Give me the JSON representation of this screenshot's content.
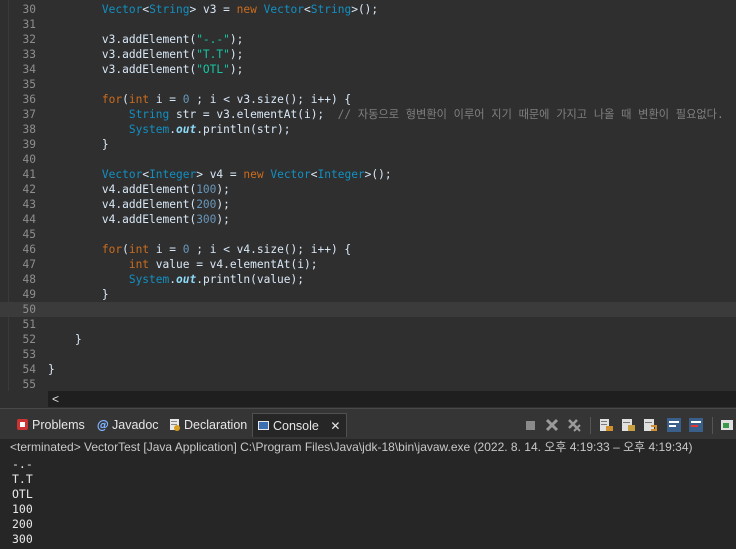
{
  "editor": {
    "lines": [
      {
        "num": "30",
        "tokens": [
          [
            "pl",
            "        "
          ],
          [
            "ty",
            "Vector"
          ],
          [
            "pl",
            "<"
          ],
          [
            "ty",
            "String"
          ],
          [
            "pl",
            "> v3 = "
          ],
          [
            "kw",
            "new"
          ],
          [
            "pl",
            " "
          ],
          [
            "ty",
            "Vector"
          ],
          [
            "pl",
            "<"
          ],
          [
            "ty",
            "String"
          ],
          [
            "pl",
            ">();"
          ]
        ]
      },
      {
        "num": "31",
        "tokens": []
      },
      {
        "num": "32",
        "tokens": [
          [
            "pl",
            "        v3.addElement("
          ],
          [
            "st",
            "\"-.-\""
          ],
          [
            "pl",
            ");"
          ]
        ]
      },
      {
        "num": "33",
        "tokens": [
          [
            "pl",
            "        v3.addElement("
          ],
          [
            "st",
            "\"T.T\""
          ],
          [
            "pl",
            ");"
          ]
        ]
      },
      {
        "num": "34",
        "tokens": [
          [
            "pl",
            "        v3.addElement("
          ],
          [
            "st",
            "\"OTL\""
          ],
          [
            "pl",
            ");"
          ]
        ]
      },
      {
        "num": "35",
        "tokens": []
      },
      {
        "num": "36",
        "tokens": [
          [
            "pl",
            "        "
          ],
          [
            "kw",
            "for"
          ],
          [
            "pl",
            "("
          ],
          [
            "kw",
            "int"
          ],
          [
            "pl",
            " i = "
          ],
          [
            "nm",
            "0"
          ],
          [
            "pl",
            " ; i < v3.size(); i++) {"
          ]
        ]
      },
      {
        "num": "37",
        "tokens": [
          [
            "pl",
            "            "
          ],
          [
            "ty",
            "String"
          ],
          [
            "pl",
            " str = v3.elementAt(i);  "
          ],
          [
            "cm",
            "// 자동으로 형변환이 이루어 지기 때문에 가지고 나올 때 변환이 필요없다."
          ]
        ]
      },
      {
        "num": "38",
        "tokens": [
          [
            "pl",
            "            "
          ],
          [
            "bi",
            "System"
          ],
          [
            "pl",
            "."
          ],
          [
            "fi",
            "out"
          ],
          [
            "pl",
            ".println(str);"
          ]
        ]
      },
      {
        "num": "39",
        "tokens": [
          [
            "pl",
            "        }"
          ]
        ]
      },
      {
        "num": "40",
        "tokens": []
      },
      {
        "num": "41",
        "tokens": [
          [
            "pl",
            "        "
          ],
          [
            "ty",
            "Vector"
          ],
          [
            "pl",
            "<"
          ],
          [
            "ty",
            "Integer"
          ],
          [
            "pl",
            "> v4 = "
          ],
          [
            "kw",
            "new"
          ],
          [
            "pl",
            " "
          ],
          [
            "ty",
            "Vector"
          ],
          [
            "pl",
            "<"
          ],
          [
            "ty",
            "Integer"
          ],
          [
            "pl",
            ">();"
          ]
        ]
      },
      {
        "num": "42",
        "tokens": [
          [
            "pl",
            "        v4.addElement("
          ],
          [
            "nm",
            "100"
          ],
          [
            "pl",
            ");"
          ]
        ]
      },
      {
        "num": "43",
        "tokens": [
          [
            "pl",
            "        v4.addElement("
          ],
          [
            "nm",
            "200"
          ],
          [
            "pl",
            ");"
          ]
        ]
      },
      {
        "num": "44",
        "tokens": [
          [
            "pl",
            "        v4.addElement("
          ],
          [
            "nm",
            "300"
          ],
          [
            "pl",
            ");"
          ]
        ]
      },
      {
        "num": "45",
        "tokens": []
      },
      {
        "num": "46",
        "tokens": [
          [
            "pl",
            "        "
          ],
          [
            "kw",
            "for"
          ],
          [
            "pl",
            "("
          ],
          [
            "kw",
            "int"
          ],
          [
            "pl",
            " i = "
          ],
          [
            "nm",
            "0"
          ],
          [
            "pl",
            " ; i < v4.size(); i++) {"
          ]
        ]
      },
      {
        "num": "47",
        "tokens": [
          [
            "pl",
            "            "
          ],
          [
            "kw",
            "int"
          ],
          [
            "pl",
            " value = v4.elementAt(i);"
          ]
        ]
      },
      {
        "num": "48",
        "tokens": [
          [
            "pl",
            "            "
          ],
          [
            "bi",
            "System"
          ],
          [
            "pl",
            "."
          ],
          [
            "fi",
            "out"
          ],
          [
            "pl",
            ".println(value);"
          ]
        ]
      },
      {
        "num": "49",
        "tokens": [
          [
            "pl",
            "        }"
          ]
        ]
      },
      {
        "num": "50",
        "tokens": []
      },
      {
        "num": "51",
        "tokens": []
      },
      {
        "num": "52",
        "tokens": [
          [
            "pl",
            "    }"
          ]
        ]
      },
      {
        "num": "53",
        "tokens": []
      },
      {
        "num": "54",
        "tokens": [
          [
            "pl",
            "}"
          ]
        ]
      },
      {
        "num": "55",
        "tokens": []
      }
    ],
    "current_line": "50",
    "hscroll_left": "<"
  },
  "tabs": [
    {
      "label": "Problems",
      "icon": "problems-icon"
    },
    {
      "label": "Javadoc",
      "icon": "javadoc-icon"
    },
    {
      "label": "Declaration",
      "icon": "declaration-icon"
    },
    {
      "label": "Console",
      "icon": "console-icon",
      "active": true
    }
  ],
  "console": {
    "header": "<terminated> VectorTest [Java Application] C:\\Program Files\\Java\\jdk-18\\bin\\javaw.exe  (2022. 8. 14. 오후 4:19:33 – 오후 4:19:34)",
    "output": [
      "-.-",
      "T.T",
      "OTL",
      "100",
      "200",
      "300"
    ]
  },
  "colors": {
    "keyword": "#cc6c1d",
    "type": "#1290c3",
    "string": "#17c6a3",
    "number": "#6897bb",
    "comment": "#808080"
  }
}
